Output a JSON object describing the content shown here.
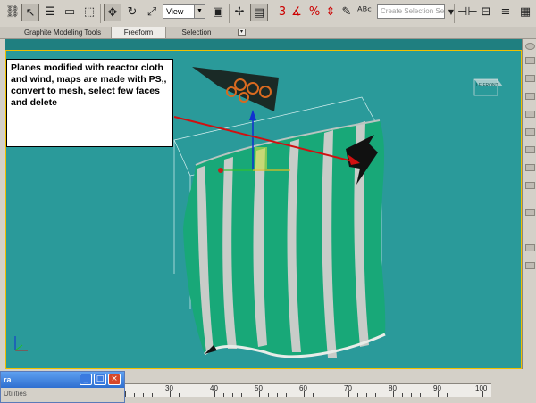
{
  "toolbar": {
    "view_select": "View",
    "selection_set_placeholder": "Create Selection Se",
    "snap_label": "3"
  },
  "ribbon": {
    "tabs": [
      {
        "label": "Graphite Modeling Tools",
        "active": false
      },
      {
        "label": "Freeform",
        "active": true
      },
      {
        "label": "Selection",
        "active": false
      }
    ],
    "dropdown_glyph": "▾"
  },
  "callout": {
    "text": "Planes modified with reactor cloth and wind, maps are made with PS,, convert to mesh, select few faces and delete"
  },
  "viewcube": {
    "label": "LE FRONT"
  },
  "timeline": {
    "labels": [
      "30",
      "40",
      "50",
      "60",
      "70",
      "80",
      "90",
      "100"
    ]
  },
  "float_window": {
    "title": "ra",
    "subtitle": "Utilities",
    "min_glyph": "_",
    "max_glyph": "□",
    "close_glyph": "×"
  },
  "colors": {
    "viewport_bg": "#2a9a9a",
    "cloth_green": "#18a878",
    "stripe_white": "#c8ccc8",
    "arrow_red": "#d01010",
    "active_border": "#f0c000"
  }
}
